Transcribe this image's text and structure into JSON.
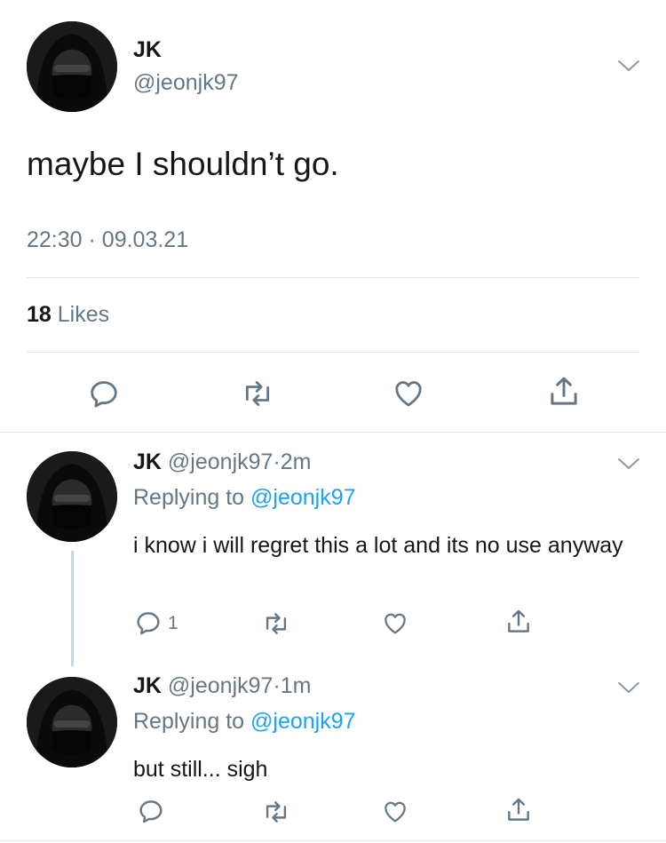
{
  "main_tweet": {
    "author_name": "JK",
    "handle": "@jeonjk97",
    "text": "maybe I shouldn’t go.",
    "time": "22:30",
    "sep": "·",
    "date": "09.03.21",
    "likes_count": "18",
    "likes_label": "Likes"
  },
  "replies": [
    {
      "author_name": "JK",
      "handle": "@jeonjk97",
      "sep": "·",
      "age": "2m",
      "replying_label": "Replying to",
      "replying_handle": "@jeonjk97",
      "text": "i know i will regret this a lot and its no use anyway",
      "reply_count": "1"
    },
    {
      "author_name": "JK",
      "handle": "@jeonjk97",
      "sep": "·",
      "age": "1m",
      "replying_label": "Replying to",
      "replying_handle": "@jeonjk97",
      "text": "but still... sigh",
      "reply_count": ""
    }
  ],
  "icons": [
    "chevron-down-icon",
    "reply-icon",
    "retweet-icon",
    "like-icon",
    "share-icon"
  ],
  "colors": {
    "text": "#14171a",
    "secondary": "#657786",
    "link": "#1da1f2",
    "divider": "#e1e8ed",
    "icon": "#657786"
  }
}
